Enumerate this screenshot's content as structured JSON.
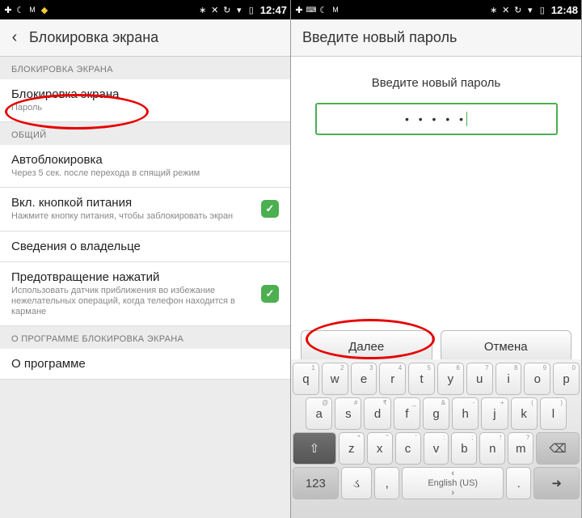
{
  "left": {
    "status": {
      "time": "12:47"
    },
    "header": {
      "title": "Блокировка экрана"
    },
    "sec1": {
      "label": "БЛОКИРОВКА ЭКРАНА"
    },
    "row_lock": {
      "title": "Блокировка экрана",
      "sub": "Пароль"
    },
    "sec2": {
      "label": "ОБЩИЙ"
    },
    "row_auto": {
      "title": "Автоблокировка",
      "sub": "Через 5 сек. после перехода в спящий режим"
    },
    "row_power": {
      "title": "Вкл. кнопкой питания",
      "sub": "Нажмите кнопку питания, чтобы заблокировать экран"
    },
    "row_owner": {
      "title": "Сведения о владельце"
    },
    "row_touch": {
      "title": "Предотвращение нажатий",
      "sub": "Использовать датчик приближения во избежание нежелательных операций, когда телефон находится в кармане"
    },
    "sec3": {
      "label": "О ПРОГРАММЕ БЛОКИРОВКА ЭКРАНА"
    },
    "row_about": {
      "title": "О программе"
    }
  },
  "right": {
    "status": {
      "time": "12:48"
    },
    "header": {
      "title": "Введите новый пароль"
    },
    "prompt": "Введите новый пароль",
    "password_masked": "• • • • •",
    "btn_next": "Далее",
    "btn_cancel": "Отмена",
    "keyboard": {
      "r1": [
        {
          "m": "q",
          "h": "1"
        },
        {
          "m": "w",
          "h": "2"
        },
        {
          "m": "e",
          "h": "3"
        },
        {
          "m": "r",
          "h": "4"
        },
        {
          "m": "t",
          "h": "5"
        },
        {
          "m": "y",
          "h": "6"
        },
        {
          "m": "u",
          "h": "7"
        },
        {
          "m": "i",
          "h": "8"
        },
        {
          "m": "o",
          "h": "9"
        },
        {
          "m": "p",
          "h": "0"
        }
      ],
      "r2": [
        {
          "m": "a",
          "h": "@"
        },
        {
          "m": "s",
          "h": "#"
        },
        {
          "m": "d",
          "h": "₹"
        },
        {
          "m": "f",
          "h": "_"
        },
        {
          "m": "g",
          "h": "&"
        },
        {
          "m": "h",
          "h": "-"
        },
        {
          "m": "j",
          "h": "+"
        },
        {
          "m": "k",
          "h": "("
        },
        {
          "m": "l",
          "h": ")"
        }
      ],
      "r3": [
        {
          "m": "z",
          "h": "*"
        },
        {
          "m": "x",
          "h": "\""
        },
        {
          "m": "c",
          "h": "'"
        },
        {
          "m": "v",
          "h": ":"
        },
        {
          "m": "b",
          "h": ";"
        },
        {
          "m": "n",
          "h": "!"
        },
        {
          "m": "m",
          "h": "?"
        }
      ],
      "space": "English (US)",
      "sym": "123",
      "comma": ",",
      "period": "."
    }
  }
}
